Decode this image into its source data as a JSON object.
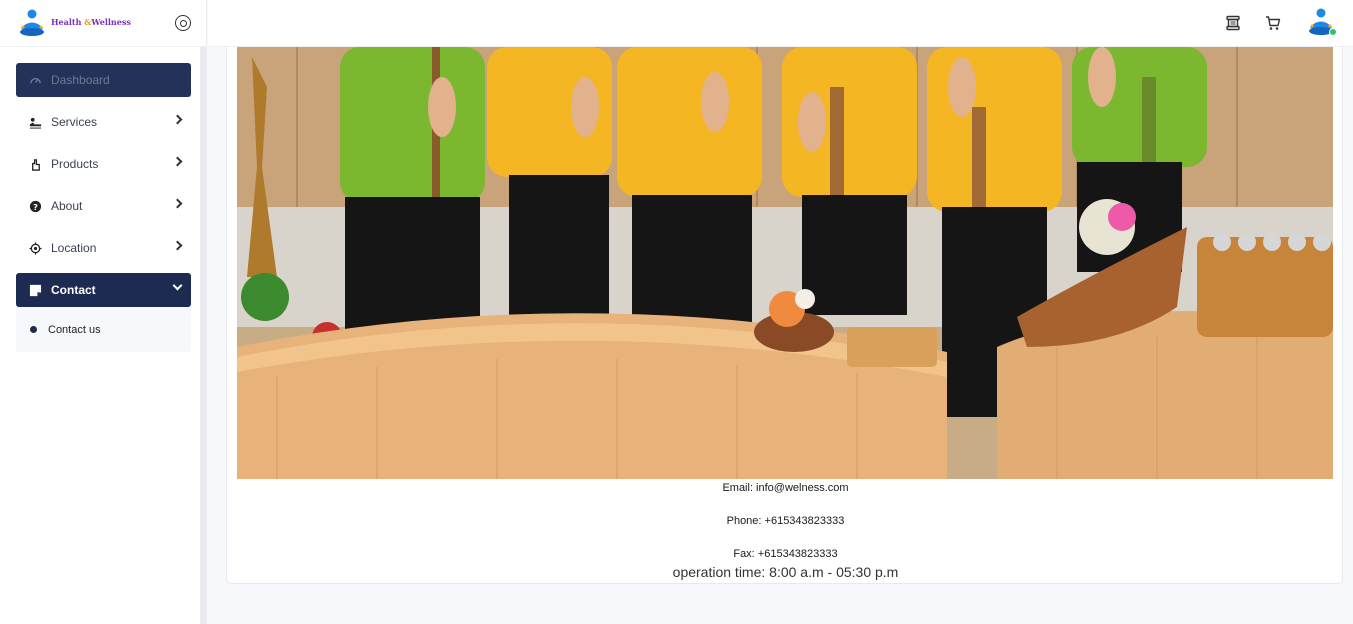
{
  "brand": {
    "name_part1": "Health",
    "name_part2": "&",
    "name_part3": "Wellness"
  },
  "sidebar": {
    "items": [
      {
        "label": "Dashboard",
        "icon": "dashboard-gauge-icon"
      },
      {
        "label": "Services",
        "icon": "massage-icon"
      },
      {
        "label": "Products",
        "icon": "hand-product-icon"
      },
      {
        "label": "About",
        "icon": "question-circle-icon"
      },
      {
        "label": "Location",
        "icon": "location-target-icon"
      },
      {
        "label": "Contact",
        "icon": "note-icon"
      }
    ],
    "submenu": {
      "label": "Contact us"
    }
  },
  "header": {
    "icons": [
      "scroll-icon",
      "cart-icon",
      "avatar-icon"
    ],
    "user_status_color": "#28c76f"
  },
  "contact": {
    "email": "Email: info@welness.com",
    "phone": "Phone: +615343823333",
    "fax": "Fax: +615343823333",
    "hours": "operation time: 8:00 a.m - 05:30 p.m"
  },
  "colors": {
    "accent": "#1d2a52",
    "dashboard_bg": "#243159",
    "page_bg": "#f7f8fc"
  }
}
